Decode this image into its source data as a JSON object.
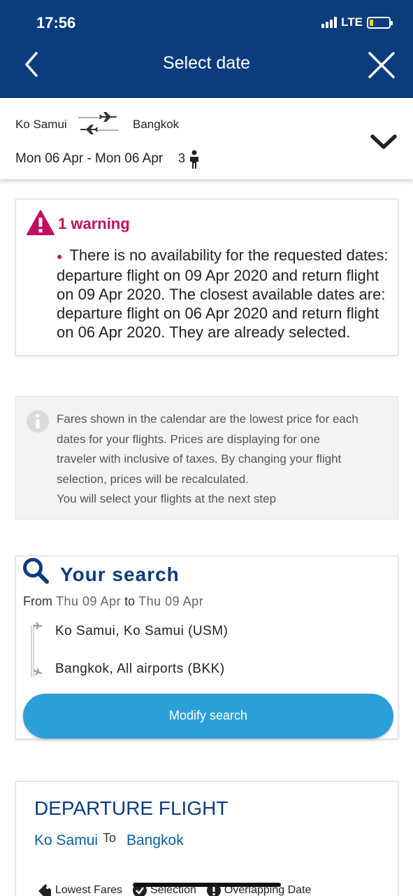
{
  "status_bar": {
    "time": "17:56",
    "network": "LTE"
  },
  "header": {
    "title": "Select date"
  },
  "summary": {
    "from": "Ko Samui",
    "to": "Bangkok",
    "dates": "Mon 06 Apr - Mon 06 Apr",
    "passengers": "3"
  },
  "warning": {
    "title": "1 warning",
    "message": "There is no availability for the requested dates: departure flight on 09 Apr 2020 and return flight on 09 Apr 2020. The closest available dates are: departure flight on 06 Apr 2020 and return flight on 06 Apr 2020. They are already selected."
  },
  "info": {
    "lines": [
      "Fares shown in the calendar are the lowest price for each",
      "dates for your flights. Prices are displaying for one",
      "traveler with inclusive of taxes. By changing your flight",
      "selection, prices will be recalculated.",
      "You will select your flights at the next step"
    ]
  },
  "search": {
    "title": "Your search",
    "from_word": "From",
    "start": "Thu 09 Apr",
    "to_word": "to",
    "end": "Thu 09 Apr",
    "origin": "Ko Samui, Ko Samui (USM)",
    "destination": "Bangkok, All airports (BKK)",
    "button": "Modify search"
  },
  "departure": {
    "title": "DEPARTURE FLIGHT",
    "from": "Ko Samui",
    "to_word": "To",
    "to": "Bangkok",
    "legend": {
      "lowest": "Lowest Fares",
      "selection": "Selection",
      "overlap": "Overlapping Date"
    }
  },
  "colors": {
    "header_bg": "#0b3d7d",
    "warning": "#c0105f",
    "button": "#2ba0d8",
    "link": "#0b5fa8"
  }
}
